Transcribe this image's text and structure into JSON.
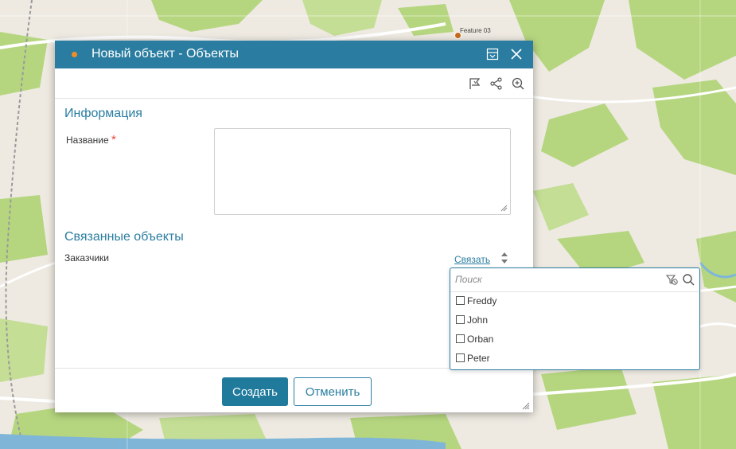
{
  "map": {
    "feature_label": "Feature 03",
    "colors": {
      "land": "#eeeae2",
      "green": "#b5d67f",
      "road": "#ffffff",
      "water": "#7fb6d8"
    }
  },
  "dialog": {
    "title": "Новый объект - Объекты",
    "title_icons": {
      "layout": "layout-icon",
      "close": "close-icon"
    },
    "toolbar_icons": [
      "map-flag-icon",
      "share-icon",
      "zoom-in-icon"
    ],
    "sections": {
      "info": {
        "title": "Информация",
        "fields": {
          "name": {
            "label": "Название",
            "required_mark": "*",
            "value": ""
          }
        }
      },
      "related": {
        "title": "Связанные объекты",
        "fields": {
          "customers": {
            "label": "Заказчики",
            "link_label": "Связать"
          }
        }
      }
    },
    "buttons": {
      "create": "Создать",
      "cancel": "Отменить"
    },
    "colors": {
      "header": "#2a7da0",
      "accent": "#2a7da0",
      "primary_button": "#1f7a9c",
      "required": "#e8473a",
      "title_dot": "#f28c28"
    }
  },
  "dropdown": {
    "search_placeholder": "Поиск",
    "options": [
      {
        "label": "Freddy",
        "checked": false
      },
      {
        "label": "John",
        "checked": false
      },
      {
        "label": "Orban",
        "checked": false
      },
      {
        "label": "Peter",
        "checked": false
      }
    ]
  }
}
